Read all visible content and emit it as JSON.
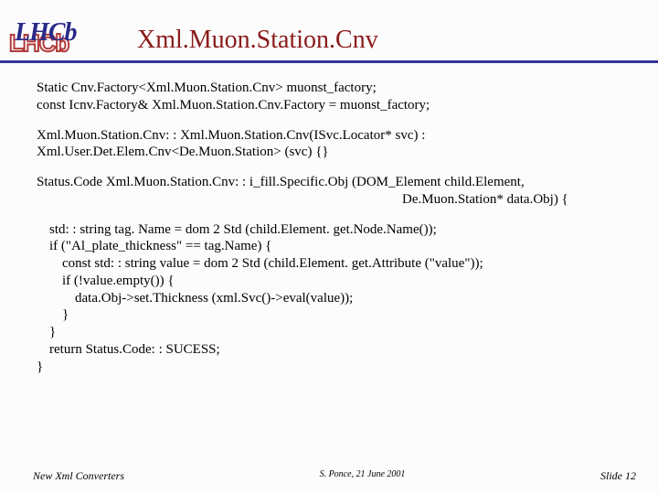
{
  "logo": {
    "back": "LHCb",
    "front": "LHCb"
  },
  "title": "Xml.Muon.Station.Cnv",
  "code": {
    "l1": "Static Cnv.Factory<Xml.Muon.Station.Cnv> muonst_factory;",
    "l2": "const Icnv.Factory& Xml.Muon.Station.Cnv.Factory = muonst_factory;",
    "l3": "Xml.Muon.Station.Cnv: : Xml.Muon.Station.Cnv(ISvc.Locator* svc) :",
    "l4": " Xml.User.Det.Elem.Cnv<De.Muon.Station> (svc) {}",
    "l5": "Status.Code Xml.Muon.Station.Cnv: : i_fill.Specific.Obj (DOM_Element child.Element,",
    "l6": "De.Muon.Station* data.Obj) {",
    "l7": "std: : string tag. Name = dom 2 Std (child.Element. get.Node.Name());",
    "l8": "if (\"Al_plate_thickness\" == tag.Name) {",
    "l9": "const std: : string value = dom 2 Std (child.Element. get.Attribute (\"value\"));",
    "l10": "if (!value.empty()) {",
    "l11": "data.Obj->set.Thickness (xml.Svc()->eval(value));",
    "l12": "}",
    "l13": "}",
    "l14": "return Status.Code: : SUCESS;",
    "l15": "}"
  },
  "footer": {
    "left": "New Xml Converters",
    "center": "S. Ponce, 21 June 2001",
    "right": "Slide 12"
  }
}
